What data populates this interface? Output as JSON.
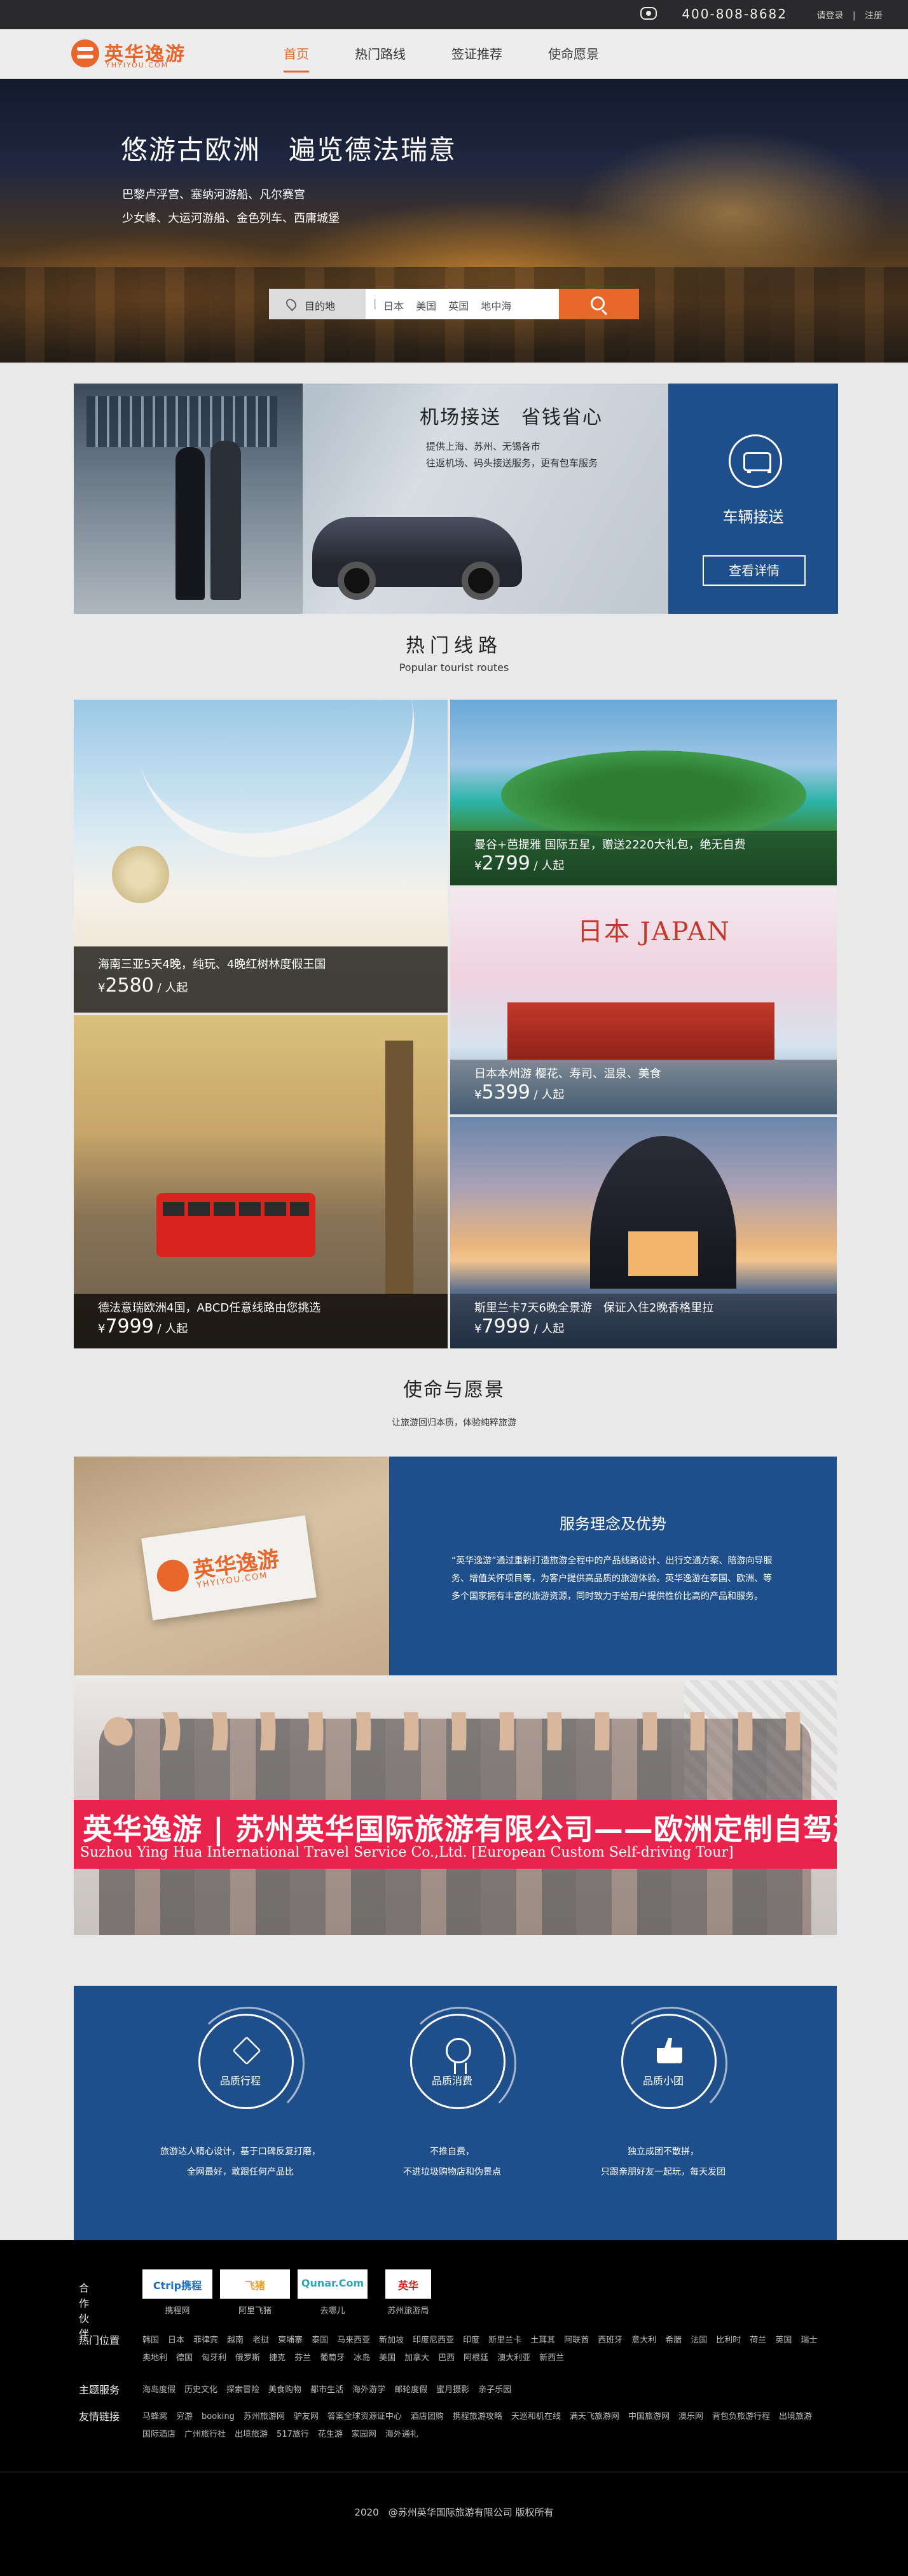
{
  "topbar": {
    "phone": "400-808-8682",
    "login": "请登录",
    "register": "注册"
  },
  "brand": {
    "name": "英华逸游",
    "domain": "YHYIYOU.COM",
    "accent": "#e8662a",
    "navy": "#1e4f8a"
  },
  "nav": {
    "items": [
      {
        "label": "首页",
        "active": true
      },
      {
        "label": "热门路线",
        "active": false
      },
      {
        "label": "签证推荐",
        "active": false
      },
      {
        "label": "使命愿景",
        "active": false
      }
    ]
  },
  "hero": {
    "title": "悠游古欧洲　遍览德法瑞意",
    "line1": "巴黎卢浮宫、塞纳河游船、凡尔赛宫",
    "line2": "少女峰、大运河游船、金色列车、西庸城堡",
    "search": {
      "dest_label": "目的地",
      "sep": "|",
      "tags": [
        "日本",
        "美国",
        "英国",
        "地中海"
      ]
    }
  },
  "banner": {
    "title": "机场接送　省钱省心",
    "desc1": "提供上海、苏州、无锡各市",
    "desc2": "往返机场、码头接送服务，更有包车服务",
    "side_title": "车辆接送",
    "more": "查看详情"
  },
  "routes": {
    "title": "热门线路",
    "subtitle": "Popular tourist routes",
    "cards": [
      {
        "title": "海南三亚5天4晚，纯玩、4晚红树林度假王国",
        "currency": "¥",
        "price": "2580",
        "unit": " / 人起"
      },
      {
        "title": "曼谷+芭提雅 国际五星，赠送2220大礼包，绝无自费",
        "currency": "¥",
        "price": "2799",
        "unit": " / 人起"
      },
      {
        "title": "日本本州游 樱花、寿司、温泉、美食",
        "currency": "¥",
        "price": "5399",
        "unit": " / 人起"
      },
      {
        "title": "德法意瑞欧洲4国，ABCD任意线路由您挑选",
        "currency": "¥",
        "price": "7999",
        "unit": " / 人起"
      },
      {
        "title": "斯里兰卡7天6晚全景游　保证入住2晚香格里拉",
        "currency": "¥",
        "price": "7999",
        "unit": " / 人起"
      }
    ],
    "japan_word": "日本 JAPAN"
  },
  "mission": {
    "title": "使命与愿景",
    "subtitle": "让旅游回归本质，体验纯粹旅游",
    "card_brand": "英华逸游",
    "card_domain": "YHYIYOU.COM",
    "box_title": "服务理念及优势",
    "box_text": "“英华逸游”通过重新打造旅游全程中的产品线路设计、出行交通方案、陪游向导服务、增值关怀项目等，为客户提供高品质的旅游体验。英华逸游在泰国、欧洲、等多个国家拥有丰富的旅游资源，同时致力于给用户提供性价比高的产品和服务。",
    "banner_line1": "英华逸游 | 苏州英华国际旅游有限公司——欧洲定制自驾游",
    "banner_line2": "Suzhou Ying Hua International Travel Service Co.,Ltd. [European Custom Self-driving Tour]"
  },
  "values": [
    {
      "label": "品质行程",
      "d1": "旅游达人精心设计，基于口碑反复打磨，",
      "d2": "全网最好，敢跟任何产品比"
    },
    {
      "label": "品质消费",
      "d1": "不推自费，",
      "d2": "不进垃圾购物店和伪景点"
    },
    {
      "label": "品质小团",
      "d1": "独立成团不散拼，",
      "d2": "只跟亲朋好友一起玩，每天发团"
    }
  ],
  "footer": {
    "partners_label": "合作伙伴",
    "partners": [
      {
        "logo": "Ctrip携程",
        "name": "携程网",
        "color": "#1d6fc4"
      },
      {
        "logo": "飞猪",
        "name": "阿里飞猪",
        "color": "#e8a21f"
      },
      {
        "logo": "Qunar.Com",
        "name": "去哪儿",
        "color": "#2aa7b8"
      },
      {
        "logo": "英华",
        "name": "苏州旅游局",
        "color": "#c8261f"
      }
    ],
    "hot_label": "热门位置",
    "hot": [
      "韩国",
      "日本",
      "菲律宾",
      "越南",
      "老挝",
      "柬埔寨",
      "泰国",
      "马来西亚",
      "新加坡",
      "印度尼西亚",
      "印度",
      "斯里兰卡",
      "土耳其",
      "阿联酋",
      "西班牙",
      "意大利",
      "希腊",
      "法国",
      "比利时",
      "荷兰",
      "英国",
      "瑞士",
      "奥地利",
      "德国",
      "匈牙利",
      "俄罗斯",
      "捷克",
      "芬兰",
      "葡萄牙",
      "冰岛",
      "美国",
      "加拿大",
      "巴西",
      "阿根廷",
      "澳大利亚",
      "新西兰"
    ],
    "theme_label": "主题服务",
    "theme": [
      "海岛度假",
      "历史文化",
      "探索冒险",
      "美食购物",
      "都市生活",
      "海外游学",
      "邮轮度假",
      "蜜月摄影",
      "亲子乐园"
    ],
    "links_label": "友情链接",
    "links": [
      "马蜂窝",
      "穷游",
      "booking",
      "苏州旅游网",
      "驴友网",
      "答案全球资源证中心",
      "酒店团购",
      "携程旅游攻略",
      "天巡和机在线",
      "满天飞旅游网",
      "中国旅游网",
      "澳乐网",
      "背包负旅游行程",
      "出境旅游",
      "国际酒店",
      "广州旅行社",
      "出境旅游",
      "517旅行",
      "花生游",
      "家园网",
      "海外通礼"
    ],
    "copyright": "2020　@苏州英华国际旅游有限公司 版权所有"
  }
}
